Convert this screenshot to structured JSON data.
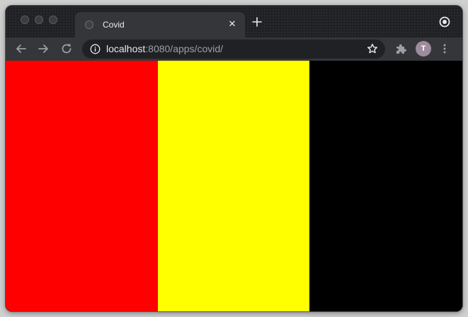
{
  "tab": {
    "title": "Covid",
    "close_glyph": "✕"
  },
  "toolbar": {
    "url_host": "localhost",
    "url_rest": ":8080/apps/covid/"
  },
  "profile": {
    "initial": "T"
  },
  "icons": {
    "back": "arrow-left-icon",
    "forward": "arrow-right-icon",
    "reload": "reload-icon",
    "info": "info-icon",
    "star": "star-icon",
    "extensions": "puzzle-piece-icon",
    "menu": "kebab-menu-icon",
    "new_tab": "plus-icon"
  },
  "page": {
    "stripes": [
      {
        "color": "#ff0000"
      },
      {
        "color": "#ffff00"
      },
      {
        "color": "#000000"
      }
    ]
  }
}
